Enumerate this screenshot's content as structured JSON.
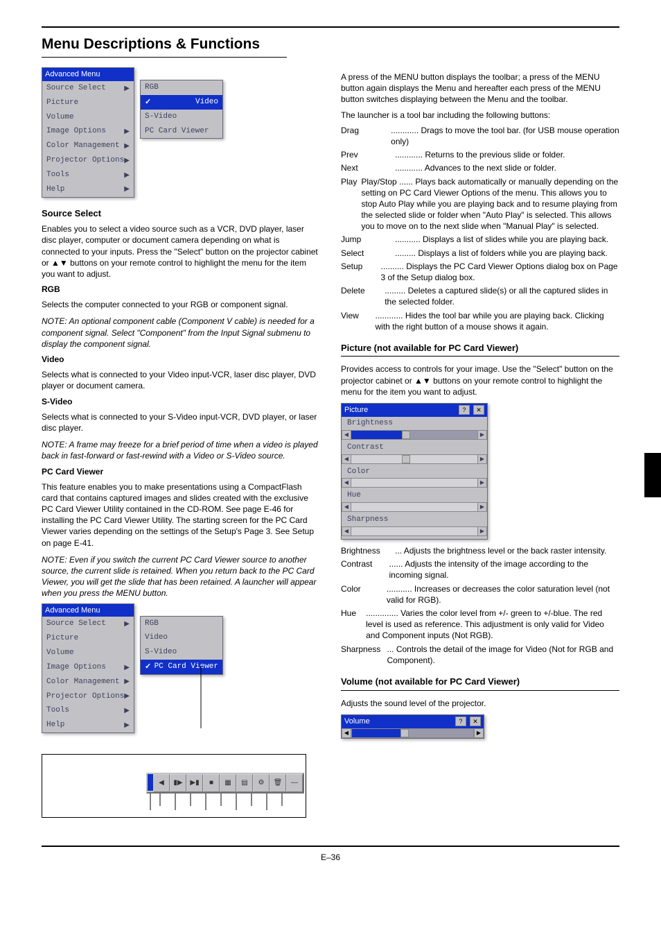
{
  "pageNumber": "E–36",
  "title": "Menu Descriptions & Functions",
  "sections": {
    "sourceSelect": {
      "heading": "Source Select",
      "intro": "Enables you to select a video source such as a VCR, DVD player, laser disc player, computer or document camera depending on what is connected to your inputs. Press the \"Select\" button on the projector cabinet or ▲▼ buttons on your remote control to highlight the menu for the item you want to adjust.",
      "rgbHeading": "RGB",
      "rgbText": "Selects the computer connected to your RGB or component signal.",
      "rgbNote": "NOTE: An optional component cable (Component V cable) is needed for a component signal. Select \"Component\" from the Input Signal submenu to display the component signal.",
      "videoHeading": "Video",
      "videoText": "Selects what is connected to your Video input-VCR, laser disc player, DVD player or document camera.",
      "svideoHeading": "S-Video",
      "svideoText": "Selects what is connected to your S-Video input-VCR, DVD player, or laser disc player.",
      "svideoNote": "NOTE: A frame may freeze for a brief period of time when a video is played back in fast-forward or fast-rewind with a Video or S-Video source.",
      "pcHeading": "PC Card Viewer",
      "pcText": "This feature enables you to make presentations using a CompactFlash card that contains captured images and slides created with the exclusive PC Card Viewer Utility contained in the CD-ROM. See page E-46 for installing the PC Card Viewer Utility. The starting screen for the PC Card Viewer varies depending on the settings of the Setup's Page 3. See Setup on page E-41.",
      "pcNote": "NOTE: Even if you switch the current PC Card Viewer source to another source, the current slide is retained. When you return back to the PC Card Viewer, you will get the slide that has been retained. A launcher will appear when you press the MENU button."
    },
    "launcherSection": {
      "intro": "A press of the MENU button displays the toolbar; a press of the MENU button again displays the Menu and hereafter each press of the MENU button switches displaying between the Menu and the toolbar.",
      "launcherText": "The launcher is a tool bar including the following buttons:",
      "items": [
        {
          "label": "Drag",
          "text": "Drags to move the tool bar. (for USB mouse operation only)"
        },
        {
          "label": "Prev",
          "text": "Returns to the previous slide or folder."
        },
        {
          "label": "Next",
          "text": "Advances to the next slide or folder."
        },
        {
          "label": "Play",
          "text": "Play/Stop ...... Plays back automatically or manually depending on the setting on PC Card Viewer Options of the menu. This allows you to stop Auto Play while you are playing back and to resume playing from the selected slide or folder when \"Auto Play\" is selected. This allows you to move on to the next slide when \"Manual Play\" is selected."
        },
        {
          "label": "Jump",
          "text": "Displays a list of slides while you are playing back."
        },
        {
          "label": "Select",
          "text": "Displays a list of folders while you are playing back."
        },
        {
          "label": "Setup",
          "text": "Displays the PC Card Viewer Options dialog box on Page 3 of the Setup dialog box."
        },
        {
          "label": "Delete",
          "text": "Deletes a captured slide(s) or all the captured slides in the selected folder."
        },
        {
          "label": "View",
          "text": "Hides the tool bar while you are playing back. Clicking with the right button of a mouse shows it again."
        }
      ]
    },
    "picture": {
      "heading": "Picture  (not available for PC Card Viewer)",
      "intro": "Provides access to controls for your image. Use the \"Select\" button on the projector cabinet or ▲▼ buttons on your remote control to highlight the menu for the item you want to adjust.",
      "adjustments": {
        "brightness": {
          "label": "Brightness",
          "text": "Adjusts the brightness level or the back raster intensity."
        },
        "contrast": {
          "label": "Contrast",
          "text": "Adjusts the intensity of the image according to the incoming signal."
        },
        "color": {
          "label": "Color",
          "text": "Increases or decreases the color saturation level (not valid for RGB)."
        },
        "hue": {
          "label": "Hue",
          "text": "Varies the color level from +/- green to +/-blue. The red level is used as reference. This adjustment is only valid for Video and Component inputs (Not RGB)."
        },
        "sharpness": {
          "label": "Sharpness",
          "text": "Controls the detail of the image for Video (Not for RGB and Component)."
        }
      }
    },
    "volume": {
      "heading": "Volume  (not available for PC Card Viewer)",
      "text": "Adjusts the sound level of the projector."
    }
  },
  "menu1": {
    "title": "Advanced Menu",
    "items": [
      "Source Select",
      "Picture",
      "Volume",
      "Image Options",
      "Color Management",
      "Projector Options",
      "Tools",
      "Help"
    ],
    "submenu": {
      "items": [
        "RGB",
        "Video",
        "S-Video",
        "PC Card Viewer"
      ],
      "selectedIndex": 1
    }
  },
  "menu2": {
    "title": "Advanced Menu",
    "items": [
      "Source Select",
      "Picture",
      "Volume",
      "Image Options",
      "Color Management",
      "Projector Options",
      "Tools",
      "Help"
    ],
    "submenu": {
      "items": [
        "RGB",
        "Video",
        "S-Video",
        "PC Card Viewer"
      ],
      "selectedIndex": 3
    }
  },
  "pictureDialog": {
    "title": "Picture",
    "sliders": [
      "Brightness",
      "Contrast",
      "Color",
      "Hue",
      "Sharpness"
    ]
  },
  "volumeDialog": {
    "title": "Volume"
  },
  "toolbarButtons": [
    "◀",
    "▮▶",
    "▶▮",
    "■",
    "▦",
    "▤",
    "⚙",
    "🗑",
    "—"
  ]
}
